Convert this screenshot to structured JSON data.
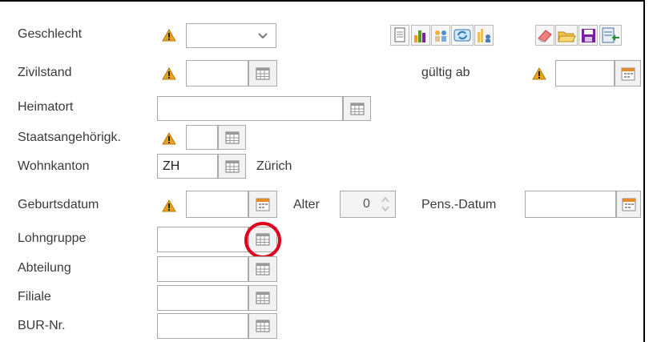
{
  "rows": {
    "geschlecht": {
      "label": "Geschlecht",
      "value": ""
    },
    "zivilstand": {
      "label": "Zivilstand",
      "value": ""
    },
    "gueltig_ab": {
      "label": "gültig ab",
      "value": ""
    },
    "heimatort": {
      "label": "Heimatort",
      "value": ""
    },
    "staatsangehoerigk": {
      "label": "Staatsangehörigk.",
      "value": ""
    },
    "wohnkanton": {
      "label": "Wohnkanton",
      "value": "ZH",
      "resolved": "Zürich"
    },
    "geburtsdatum": {
      "label": "Geburtsdatum",
      "value": ""
    },
    "alter": {
      "label": "Alter",
      "value": "0"
    },
    "pens_datum": {
      "label": "Pens.-Datum",
      "value": ""
    },
    "lohngruppe": {
      "label": "Lohngruppe",
      "value": ""
    },
    "abteilung": {
      "label": "Abteilung",
      "value": ""
    },
    "filiale": {
      "label": "Filiale",
      "value": ""
    },
    "bur_nr": {
      "label": "BUR-Nr.",
      "value": ""
    }
  },
  "toolbar": {
    "icons": [
      "document-icon",
      "bar-chart-icon",
      "people-icon",
      "sync-icon",
      "bar-person-icon",
      "eraser-icon",
      "folder-open-icon",
      "save-icon",
      "export-icon"
    ]
  },
  "colors": {
    "warning": "#e8a317",
    "highlight": "#e0001b",
    "save": "#7b1fa2"
  }
}
